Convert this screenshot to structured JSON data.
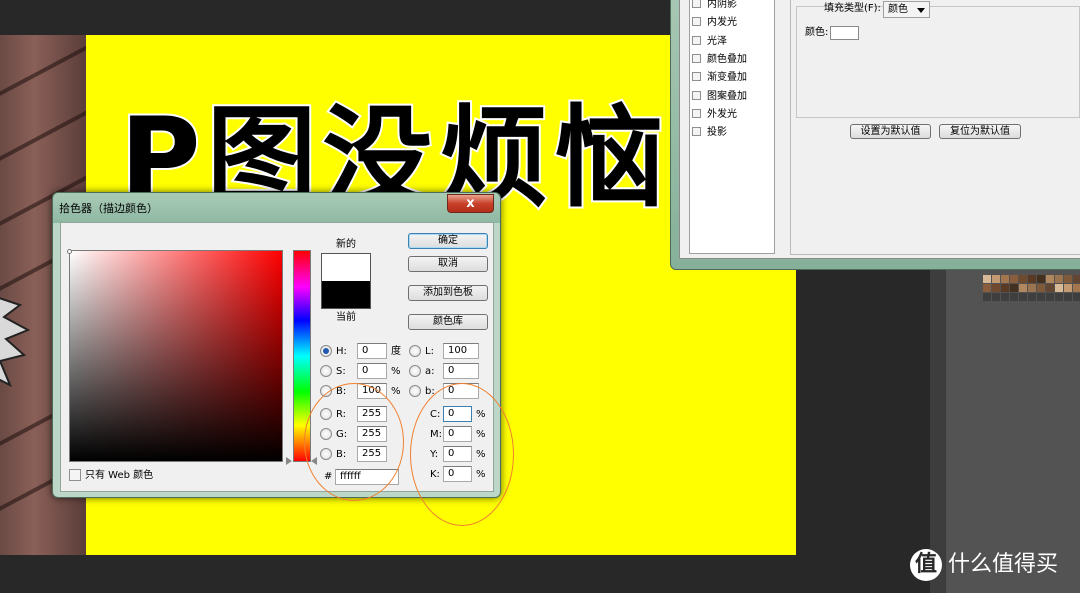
{
  "canvas": {
    "headline": "P图没烦恼",
    "background_color": "#ffff00"
  },
  "layer_style": {
    "effects": [
      "内阴影",
      "内发光",
      "光泽",
      "颜色叠加",
      "渐变叠加",
      "图案叠加",
      "外发光",
      "投影"
    ],
    "fill_type_label": "填充类型(F):",
    "fill_type_value": "颜色",
    "color_label": "颜色:",
    "set_default_button": "设置为默认值",
    "reset_default_button": "复位为默认值"
  },
  "color_picker": {
    "title": "拾色器（描边颜色）",
    "close_glyph": "x",
    "new_label": "新的",
    "current_label": "当前",
    "new_color": "#ffffff",
    "current_color": "#000000",
    "buttons": {
      "ok": "确定",
      "cancel": "取消",
      "add_to_swatches": "添加到色板",
      "color_libraries": "颜色库"
    },
    "hsb": [
      {
        "label": "H:",
        "value": "0",
        "unit": "度",
        "selected": true
      },
      {
        "label": "S:",
        "value": "0",
        "unit": "%",
        "selected": false
      },
      {
        "label": "B:",
        "value": "100",
        "unit": "%",
        "selected": false
      }
    ],
    "rgb": [
      {
        "label": "R:",
        "value": "255"
      },
      {
        "label": "G:",
        "value": "255"
      },
      {
        "label": "B:",
        "value": "255"
      }
    ],
    "lab": [
      {
        "label": "L:",
        "value": "100"
      },
      {
        "label": "a:",
        "value": "0"
      },
      {
        "label": "b:",
        "value": "0"
      }
    ],
    "cmyk": [
      {
        "label": "C:",
        "value": "0",
        "unit": "%"
      },
      {
        "label": "M:",
        "value": "0",
        "unit": "%"
      },
      {
        "label": "Y:",
        "value": "0",
        "unit": "%"
      },
      {
        "label": "K:",
        "value": "0",
        "unit": "%"
      }
    ],
    "hex_label": "#",
    "hex_value": "ffffff",
    "web_only_label": "只有 Web 颜色",
    "web_only_checked": false
  },
  "annotation_color": "#f08030",
  "watermark": {
    "logo_glyph": "值",
    "text": "什么值得买"
  }
}
